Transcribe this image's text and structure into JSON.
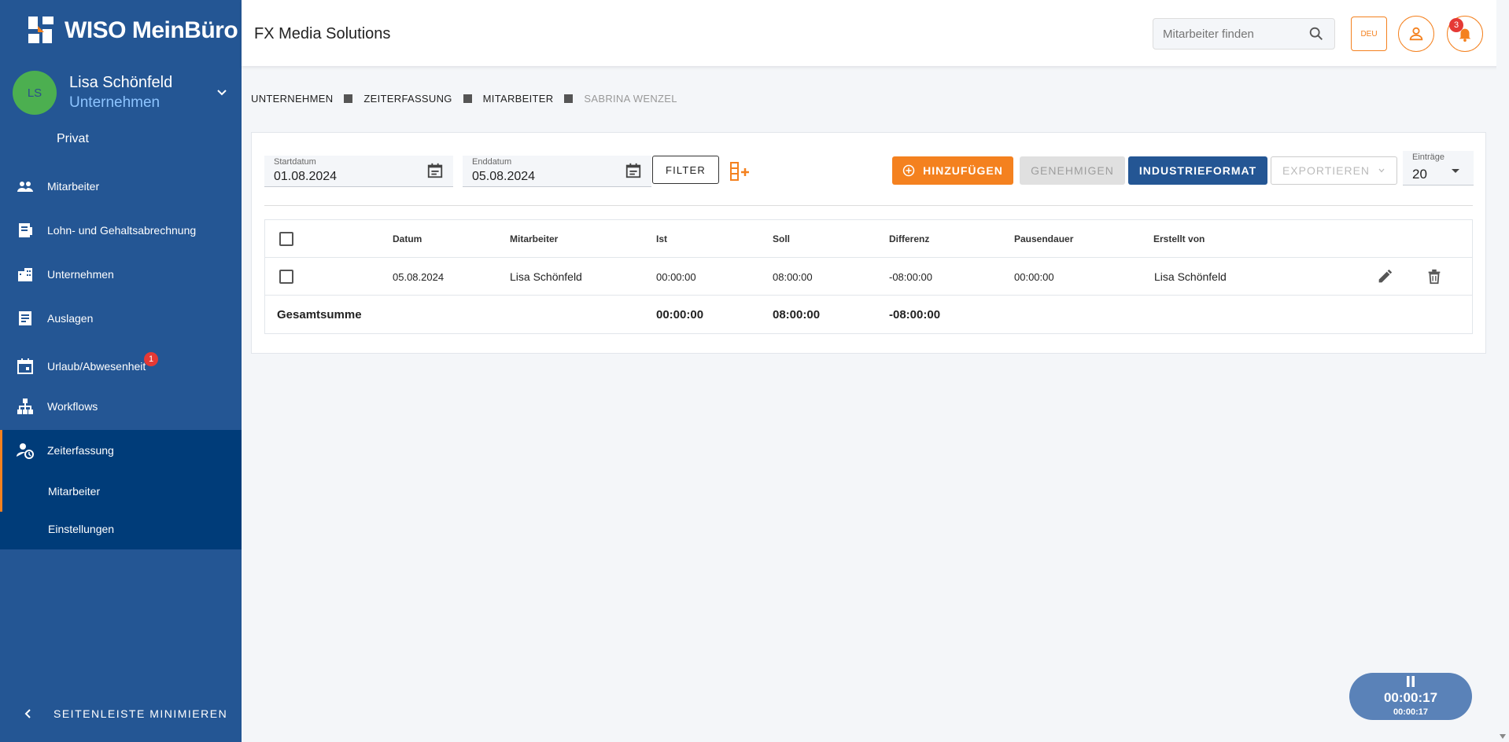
{
  "brand": {
    "name": "WISO MeinBüro",
    "accent": "#f4811f",
    "primary": "#245694"
  },
  "user": {
    "initials": "LS",
    "name": "Lisa Schönfeld",
    "context": "Unternehmen",
    "alt_context": "Privat"
  },
  "sidebar": {
    "items": [
      {
        "label": "Mitarbeiter",
        "icon": "people-icon"
      },
      {
        "label": "Lohn- und Gehaltsabrechnung",
        "icon": "payroll-icon"
      },
      {
        "label": "Unternehmen",
        "icon": "building-icon"
      },
      {
        "label": "Auslagen",
        "icon": "receipt-icon"
      },
      {
        "label": "Urlaub/Abwesenheit",
        "icon": "calendar-icon",
        "badge": "1"
      },
      {
        "label": "Workflows",
        "icon": "workflow-icon"
      },
      {
        "label": "Zeiterfassung",
        "icon": "time-tracking-icon"
      }
    ],
    "sub_items": [
      {
        "label": "Mitarbeiter"
      },
      {
        "label": "Einstellungen"
      }
    ],
    "minimize_label": "SEITENLEISTE MINIMIEREN"
  },
  "header": {
    "company": "FX Media Solutions",
    "search_placeholder": "Mitarbeiter finden",
    "language": "DEU",
    "notification_count": "3"
  },
  "breadcrumb": [
    "UNTERNEHMEN",
    "ZEITERFASSUNG",
    "MITARBEITER",
    "SABRINA WENZEL"
  ],
  "toolbar": {
    "start_label": "Startdatum",
    "start_value": "01.08.2024",
    "end_label": "Enddatum",
    "end_value": "05.08.2024",
    "filter_label": "FILTER",
    "add_label": "HINZUFÜGEN",
    "approve_label": "GENEHMIGEN",
    "industry_label": "INDUSTRIEFORMAT",
    "export_label": "EXPORTIEREN",
    "entries_label": "Einträge",
    "entries_value": "20"
  },
  "table": {
    "columns": [
      "Datum",
      "Mitarbeiter",
      "Ist",
      "Soll",
      "Differenz",
      "Pausendauer",
      "Erstellt von"
    ],
    "rows": [
      {
        "datum": "05.08.2024",
        "mitarbeiter": "Lisa Schönfeld",
        "ist": "00:00:00",
        "soll": "08:00:00",
        "differenz": "-08:00:00",
        "pausendauer": "00:00:00",
        "erstellt_von": "Lisa Schönfeld"
      }
    ],
    "total": {
      "label": "Gesamtsumme",
      "ist": "00:00:00",
      "soll": "08:00:00",
      "differenz": "-08:00:00"
    }
  },
  "timer": {
    "main": "00:00:17",
    "sub": "00:00:17"
  }
}
